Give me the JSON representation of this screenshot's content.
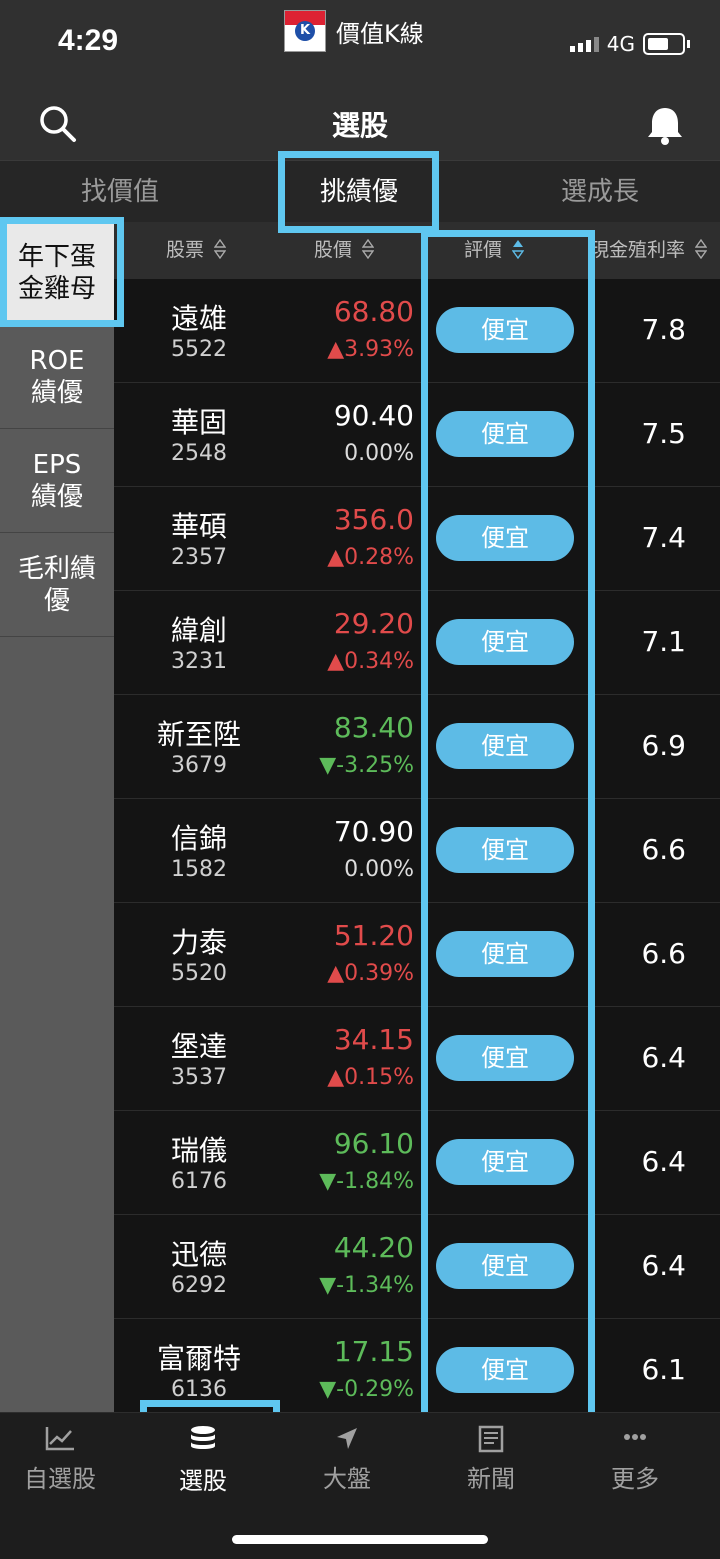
{
  "status_bar": {
    "time": "4:29",
    "app_name": "價值K線",
    "app_logo_letter": "K",
    "network": "4G"
  },
  "header": {
    "title": "選股",
    "left_icon": "search-icon",
    "right_icon": "bell-icon"
  },
  "top_tabs": [
    {
      "label": "找價值",
      "active": false
    },
    {
      "label": "挑績優",
      "active": true
    },
    {
      "label": "選成長",
      "active": false
    }
  ],
  "side_nav": [
    {
      "line1": "年下蛋",
      "line2": "金雞母",
      "active": true
    },
    {
      "line1": "ROE",
      "line2": "績優",
      "active": false
    },
    {
      "line1": "EPS",
      "line2": "績優",
      "active": false
    },
    {
      "line1": "毛利績",
      "line2": "優",
      "active": false
    }
  ],
  "table": {
    "headers": {
      "stock": "股票",
      "price": "股價",
      "rating": "評價",
      "yield": "現金殖利率"
    },
    "rows": [
      {
        "name": "遠雄",
        "code": "5522",
        "price": "68.80",
        "change": "▲3.93%",
        "dir": "up",
        "rating": "便宜",
        "yield": "7.8"
      },
      {
        "name": "華固",
        "code": "2548",
        "price": "90.40",
        "change": "0.00%",
        "dir": "flat",
        "rating": "便宜",
        "yield": "7.5"
      },
      {
        "name": "華碩",
        "code": "2357",
        "price": "356.0",
        "change": "▲0.28%",
        "dir": "up",
        "rating": "便宜",
        "yield": "7.4"
      },
      {
        "name": "緯創",
        "code": "3231",
        "price": "29.20",
        "change": "▲0.34%",
        "dir": "up",
        "rating": "便宜",
        "yield": "7.1"
      },
      {
        "name": "新至陞",
        "code": "3679",
        "price": "83.40",
        "change": "▼-3.25%",
        "dir": "down",
        "rating": "便宜",
        "yield": "6.9"
      },
      {
        "name": "信錦",
        "code": "1582",
        "price": "70.90",
        "change": "0.00%",
        "dir": "flat",
        "rating": "便宜",
        "yield": "6.6"
      },
      {
        "name": "力泰",
        "code": "5520",
        "price": "51.20",
        "change": "▲0.39%",
        "dir": "up",
        "rating": "便宜",
        "yield": "6.6"
      },
      {
        "name": "堡達",
        "code": "3537",
        "price": "34.15",
        "change": "▲0.15%",
        "dir": "up",
        "rating": "便宜",
        "yield": "6.4"
      },
      {
        "name": "瑞儀",
        "code": "6176",
        "price": "96.10",
        "change": "▼-1.84%",
        "dir": "down",
        "rating": "便宜",
        "yield": "6.4"
      },
      {
        "name": "迅德",
        "code": "6292",
        "price": "44.20",
        "change": "▼-1.34%",
        "dir": "down",
        "rating": "便宜",
        "yield": "6.4"
      },
      {
        "name": "富爾特",
        "code": "6136",
        "price": "17.15",
        "change": "▼-0.29%",
        "dir": "down",
        "rating": "便宜",
        "yield": "6.1"
      }
    ]
  },
  "bottom_tabs": [
    {
      "label": "自選股",
      "icon": "chart-line-icon",
      "active": false
    },
    {
      "label": "選股",
      "icon": "database-stack-icon",
      "active": true
    },
    {
      "label": "大盤",
      "icon": "navigation-arrow-icon",
      "active": false
    },
    {
      "label": "新聞",
      "icon": "newspaper-icon",
      "active": false
    },
    {
      "label": "更多",
      "icon": "more-dots-icon",
      "active": false
    }
  ],
  "colors": {
    "up": "#e14b4b",
    "down": "#5dbb5a",
    "pill": "#5dbbe6",
    "highlight": "#5fc7f0"
  }
}
